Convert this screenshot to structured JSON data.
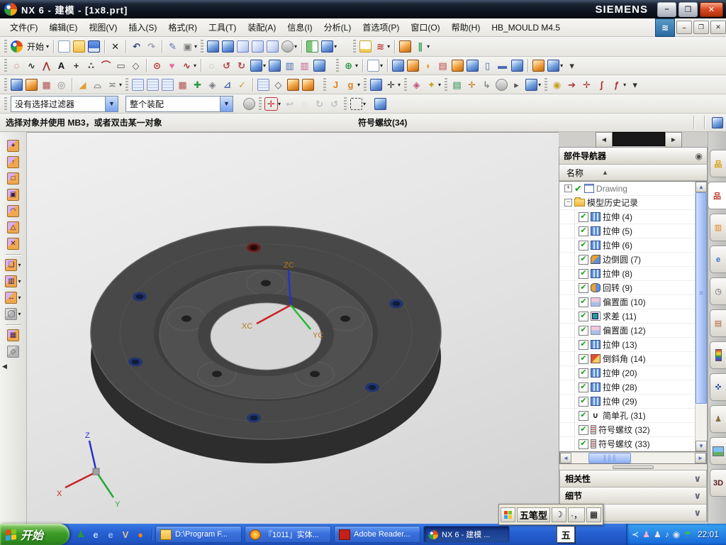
{
  "window": {
    "title": "NX 6 - 建模 - [1x8.prt]",
    "brand": "SIEMENS",
    "min_label": "–",
    "max_label": "❐",
    "close_label": "✕"
  },
  "menu_bar": {
    "items": [
      "文件(F)",
      "编辑(E)",
      "视图(V)",
      "插入(S)",
      "格式(R)",
      "工具(T)",
      "装配(A)",
      "信息(I)",
      "分析(L)",
      "首选项(P)",
      "窗口(O)",
      "帮助(H)"
    ],
    "suffix": "HB_MOULD M4.5"
  },
  "toolbars": {
    "row1": [
      {
        "t": "grip"
      },
      {
        "n": "nx-start-logo",
        "k": "logo"
      },
      {
        "n": "start-menu",
        "k": "label",
        "g": "开始",
        "a": 1
      },
      {
        "t": "sep"
      },
      {
        "n": "new-part",
        "k": "page"
      },
      {
        "n": "open-part",
        "k": "folder"
      },
      {
        "n": "save-part",
        "k": "floppy"
      },
      {
        "t": "sep"
      },
      {
        "n": "delete",
        "k": "glyph",
        "g": "✕",
        "c": "#1a1a1a"
      },
      {
        "t": "sep"
      },
      {
        "n": "undo",
        "k": "glyph",
        "g": "↶",
        "c": "#33427a"
      },
      {
        "n": "redo",
        "k": "glyph",
        "g": "↷",
        "c": "#9aa0ae"
      },
      {
        "t": "sep"
      },
      {
        "n": "measure-distance",
        "k": "glyph",
        "g": "✎",
        "c": "#5a6fb0"
      },
      {
        "n": "screen-layout",
        "k": "glyph",
        "g": "▣",
        "c": "#7a7a7a",
        "a": 1
      },
      {
        "t": "grip"
      },
      {
        "n": "shaded-with-edges",
        "k": "cubeb"
      },
      {
        "n": "shaded",
        "k": "cubeb"
      },
      {
        "n": "wireframe-dim-edges",
        "k": "cube"
      },
      {
        "n": "wireframe-hidden-edges",
        "k": "cube"
      },
      {
        "n": "static-wireframe",
        "k": "cube"
      },
      {
        "n": "face-analysis",
        "k": "gray",
        "a": 1
      },
      {
        "t": "sep"
      },
      {
        "n": "orient-view-left",
        "k": "split"
      },
      {
        "n": "orient-view",
        "k": "cubeb",
        "a": 1
      },
      {
        "t": "gap",
        "w": 18
      },
      {
        "t": "grip"
      },
      {
        "n": "datum-display",
        "k": "docy"
      },
      {
        "n": "edge-display",
        "k": "glyph",
        "g": "≋",
        "c": "#c03030",
        "a": 1
      },
      {
        "t": "sep"
      },
      {
        "n": "role-designer",
        "k": "cubeo"
      },
      {
        "n": "routing-pipes",
        "k": "glyph",
        "g": "∥",
        "c": "#2a9a4a",
        "a": 1
      }
    ],
    "row2": [
      {
        "t": "grip"
      },
      {
        "n": "profile",
        "k": "glyph",
        "g": "◌",
        "c": "#b03030"
      },
      {
        "n": "spline",
        "k": "glyph",
        "g": "∿",
        "c": "#333333"
      },
      {
        "n": "polyline",
        "k": "glyph",
        "g": "⋀",
        "c": "#a03030"
      },
      {
        "n": "sketch-text",
        "k": "glyph",
        "g": "A",
        "c": "#111111"
      },
      {
        "n": "point",
        "k": "glyph",
        "g": "+",
        "c": "#333333"
      },
      {
        "n": "point-set",
        "k": "glyph",
        "g": "∴",
        "c": "#555555"
      },
      {
        "n": "sketch-fillet",
        "k": "glyph",
        "g": "⌒",
        "c": "#b03030"
      },
      {
        "n": "rectangle",
        "k": "glyph",
        "g": "▭",
        "c": "#555555"
      },
      {
        "n": "polygon",
        "k": "glyph",
        "g": "◇",
        "c": "#555555"
      },
      {
        "t": "sep"
      },
      {
        "n": "ellipse",
        "k": "glyph",
        "g": "⊙",
        "c": "#b03030"
      },
      {
        "n": "conic",
        "k": "glyph",
        "g": "♥",
        "c": "#e070a0"
      },
      {
        "n": "studio-spline",
        "k": "glyph",
        "g": "∿",
        "c": "#b03030",
        "a": 1
      },
      {
        "t": "sep"
      },
      {
        "n": "quick-trim",
        "k": "glyph",
        "g": "◌",
        "c": "#999999"
      },
      {
        "n": "quick-extend",
        "k": "glyph",
        "g": "↺",
        "c": "#b04040"
      },
      {
        "n": "make-corner",
        "k": "glyph",
        "g": "↻",
        "c": "#b04040"
      },
      {
        "n": "sketch",
        "k": "cubeb",
        "a": 1
      },
      {
        "n": "sketch-in-task",
        "k": "cubeb"
      },
      {
        "n": "sketch-curve",
        "k": "glyph",
        "g": "▥",
        "c": "#4a6ab0"
      },
      {
        "n": "sketch-constraints",
        "k": "glyph",
        "g": "▥",
        "c": "#c06090"
      },
      {
        "n": "finish-sketch",
        "k": "cubeb"
      },
      {
        "t": "gap",
        "w": 10
      },
      {
        "t": "grip"
      },
      {
        "n": "datum-csys",
        "k": "glyph",
        "g": "⊕",
        "c": "#2a9a4a",
        "a": 1
      },
      {
        "t": "sep"
      },
      {
        "n": "datum-plane",
        "k": "page",
        "a": 1
      },
      {
        "t": "sep"
      },
      {
        "n": "extrude",
        "k": "cubeb"
      },
      {
        "n": "revolve",
        "k": "cubeo"
      },
      {
        "n": "sweep-along-guide",
        "k": "glyph",
        "g": "◖",
        "c": "#e0a020"
      },
      {
        "n": "emboss",
        "k": "glyph",
        "g": "▤",
        "c": "#c04040"
      },
      {
        "n": "hole",
        "k": "cubeo"
      },
      {
        "n": "pocket",
        "k": "cubeb"
      },
      {
        "n": "boss",
        "k": "glyph",
        "g": "▯",
        "c": "#4a6ab0"
      },
      {
        "n": "slot",
        "k": "glyph",
        "g": "▬",
        "c": "#4a6ab0"
      },
      {
        "n": "groove",
        "k": "cubeb"
      },
      {
        "t": "sep"
      },
      {
        "n": "unite",
        "k": "cubeo"
      },
      {
        "n": "subtract",
        "k": "cubeb",
        "a": 1
      },
      {
        "n": "toolbar-options",
        "k": "glyph",
        "g": "▾",
        "c": "#333333"
      }
    ],
    "row3": [
      {
        "t": "grip"
      },
      {
        "n": "extract-body",
        "k": "cubeb"
      },
      {
        "n": "shell",
        "k": "cubeo"
      },
      {
        "n": "pattern-feature",
        "k": "glyph",
        "g": "▦",
        "c": "#b05050"
      },
      {
        "n": "tube",
        "k": "glyph",
        "g": "◎",
        "c": "#888888"
      },
      {
        "t": "sep"
      },
      {
        "n": "trim-body",
        "k": "glyph",
        "g": "◢",
        "c": "#e0a030"
      },
      {
        "n": "dome",
        "k": "glyph",
        "g": "⌓",
        "c": "#888888"
      },
      {
        "n": "offset-face",
        "k": "glyph",
        "g": "≍",
        "c": "#888888",
        "a": 1
      },
      {
        "t": "grip"
      },
      {
        "n": "ruled-surface",
        "k": "sheet"
      },
      {
        "n": "through-curves",
        "k": "sheet"
      },
      {
        "n": "through-curve-mesh",
        "k": "sheet"
      },
      {
        "n": "lattice-surface",
        "k": "glyph",
        "g": "▦",
        "c": "#b05050"
      },
      {
        "n": "n-sided-surface",
        "k": "glyph",
        "g": "✚",
        "c": "#2a9a4a"
      },
      {
        "n": "sew",
        "k": "glyph",
        "g": "◈",
        "c": "#777788"
      },
      {
        "n": "trim-sheet",
        "k": "glyph",
        "g": "⊿",
        "c": "#4a6ab0"
      },
      {
        "n": "surface-wand",
        "k": "glyph",
        "g": "✓",
        "c": "#c8a020"
      },
      {
        "t": "sep"
      },
      {
        "n": "grid-surface",
        "k": "sheet"
      },
      {
        "n": "bow-surface",
        "k": "glyph",
        "g": "◇",
        "c": "#555566"
      },
      {
        "n": "swoop-surface",
        "k": "cubeo"
      },
      {
        "n": "bounded-plane",
        "k": "cubeo"
      },
      {
        "t": "gap",
        "w": 8
      },
      {
        "t": "grip"
      },
      {
        "n": "edge-blend",
        "k": "glyph",
        "g": "J",
        "c": "#e08020"
      },
      {
        "n": "face-blend",
        "k": "glyph",
        "g": "g",
        "c": "#e08020",
        "a": 1
      },
      {
        "t": "grip"
      },
      {
        "n": "view-section",
        "k": "cubeb"
      },
      {
        "n": "wcs-dynamics",
        "k": "glyph",
        "g": "✛",
        "c": "#333333",
        "a": 1
      },
      {
        "t": "grip"
      },
      {
        "n": "information-window",
        "k": "glyph",
        "g": "◈",
        "c": "#c05080"
      },
      {
        "n": "visualization-preferences",
        "k": "glyph",
        "g": "✦",
        "c": "#c8a020",
        "a": 1
      },
      {
        "t": "grip"
      },
      {
        "n": "layer-settings",
        "k": "glyph",
        "g": "▤",
        "c": "#2a8a4a"
      },
      {
        "n": "csys-orientation",
        "k": "glyph",
        "g": "✛",
        "c": "#c07820"
      },
      {
        "n": "unlock-objects",
        "k": "glyph",
        "g": "↳",
        "c": "#888888"
      },
      {
        "n": "ghost-body",
        "k": "gray"
      },
      {
        "n": "selection-arrow",
        "k": "glyph",
        "g": "▸",
        "c": "#555555"
      },
      {
        "n": "move-component",
        "k": "cubeb",
        "a": 1
      },
      {
        "t": "grip"
      },
      {
        "n": "snap-ball",
        "k": "glyph",
        "g": "◉",
        "c": "#c8a020"
      },
      {
        "n": "derived-line",
        "k": "glyph",
        "g": "➔",
        "c": "#b03030"
      },
      {
        "n": "snap-cross",
        "k": "glyph",
        "g": "✛",
        "c": "#b03030"
      },
      {
        "n": "law-curve",
        "k": "glyph",
        "g": "∫",
        "c": "#b03030"
      },
      {
        "n": "spline-law",
        "k": "glyph",
        "g": "ƒ",
        "c": "#b03030",
        "a": 1
      },
      {
        "n": "toolbar-options-2",
        "k": "glyph",
        "g": "▾",
        "c": "#333333"
      }
    ],
    "selection_row": [
      {
        "t": "grip"
      },
      {
        "t": "dd",
        "bind": "filter",
        "nm": "selection-filter-dropdown"
      },
      {
        "t": "gap",
        "w": 6
      },
      {
        "t": "dd",
        "bind": "scope",
        "nm": "selection-scope-dropdown"
      },
      {
        "t": "gap",
        "w": 10
      },
      {
        "n": "select-within-assembly",
        "k": "gray"
      },
      {
        "t": "grip"
      },
      {
        "n": "snap-point-toggle",
        "k": "glyph",
        "g": "✛",
        "c": "#c03030",
        "a": 1,
        "box": 1
      },
      {
        "n": "step-back",
        "k": "glyph",
        "g": "↩",
        "c": "#99a0aa",
        "dim": 1
      },
      {
        "n": "deselect-all",
        "k": "glyph",
        "g": "◌",
        "c": "#99a0aa",
        "dim": 1
      },
      {
        "n": "rotate-view",
        "k": "glyph",
        "g": "↻",
        "c": "#99a0aa",
        "dim": 1
      },
      {
        "n": "pan-view",
        "k": "glyph",
        "g": "↺",
        "c": "#99a0aa",
        "dim": 1
      },
      {
        "t": "grip"
      },
      {
        "n": "rectangle-select",
        "k": "marquee",
        "a": 1
      },
      {
        "t": "gap",
        "w": 8
      },
      {
        "n": "preview-shaded",
        "k": "cubeb"
      }
    ],
    "sidebar": [
      {
        "n": "move-face",
        "k": "scube",
        "g": "+"
      },
      {
        "n": "pull-face",
        "k": "scube",
        "g": "↑"
      },
      {
        "n": "offset-region",
        "k": "scube",
        "g": "□"
      },
      {
        "n": "replace-face",
        "k": "scube",
        "g": "▣"
      },
      {
        "n": "resize-blend",
        "k": "scube",
        "g": "◠"
      },
      {
        "n": "resize-face",
        "k": "scube",
        "g": "△"
      },
      {
        "n": "delete-face",
        "k": "scube",
        "g": "✕"
      },
      {
        "t": "hsep"
      },
      {
        "n": "copy-face",
        "k": "scube",
        "g": "❏",
        "a": 1
      },
      {
        "n": "paste-face",
        "k": "scube",
        "g": "▥",
        "a": 1
      },
      {
        "n": "linear-dimension",
        "k": "scube",
        "g": "↔",
        "a": 1
      },
      {
        "n": "shell-body",
        "k": "sgray",
        "g": "◯",
        "a": 1
      },
      {
        "t": "hsep"
      },
      {
        "n": "pattern-face",
        "k": "scube",
        "g": "▦"
      },
      {
        "n": "edit-cross-section",
        "k": "sgray",
        "g": "◇"
      },
      {
        "t": "collapse"
      }
    ]
  },
  "selection_bar": {
    "filter_value": "没有选择过滤器",
    "scope_value": "整个装配"
  },
  "status_bar": {
    "prompt": "选择对象并使用 MB3，或者双击某一对象",
    "message": "符号螺纹(34)"
  },
  "viewport": {
    "wcs": {
      "x": "XC",
      "y": "YC",
      "z": "ZC"
    },
    "triad": {
      "x": "X",
      "y": "Y",
      "z": "Z"
    }
  },
  "part_navigator": {
    "title": "部件导航器",
    "column": "名称",
    "tree": [
      {
        "label": "Drawing",
        "icon": "drawing",
        "exp": "+",
        "check": "mark",
        "level": 0,
        "muted": true
      },
      {
        "label": "模型历史记录",
        "icon": "folder",
        "exp": "−",
        "level": 0
      },
      {
        "label": "拉伸 (4)",
        "icon": "extrude",
        "checked": true
      },
      {
        "label": "拉伸 (5)",
        "icon": "extrude",
        "checked": true
      },
      {
        "label": "拉伸 (6)",
        "icon": "extrude",
        "checked": true
      },
      {
        "label": "边倒圆 (7)",
        "icon": "blend",
        "checked": true
      },
      {
        "label": "拉伸 (8)",
        "icon": "extrude",
        "checked": true
      },
      {
        "label": "回转 (9)",
        "icon": "revolve",
        "checked": true
      },
      {
        "label": "偏置面 (10)",
        "icon": "offset",
        "checked": true
      },
      {
        "label": "求差 (11)",
        "icon": "subtract",
        "checked": true
      },
      {
        "label": "偏置面 (12)",
        "icon": "offset",
        "checked": true
      },
      {
        "label": "拉伸 (13)",
        "icon": "extrude",
        "checked": true
      },
      {
        "label": "倒斜角 (14)",
        "icon": "chamfer",
        "checked": true
      },
      {
        "label": "拉伸 (20)",
        "icon": "extrude",
        "checked": true
      },
      {
        "label": "拉伸 (28)",
        "icon": "extrude",
        "checked": true
      },
      {
        "label": "拉伸 (29)",
        "icon": "extrude",
        "checked": true
      },
      {
        "label": "简单孔 (31)",
        "icon": "hole",
        "glyph": "∪",
        "checked": true
      },
      {
        "label": "符号螺纹 (32)",
        "icon": "thread",
        "checked": true
      },
      {
        "label": "符号螺纹 (33)",
        "icon": "thread",
        "checked": true
      }
    ],
    "sections": [
      "相关性",
      "细节",
      ""
    ]
  },
  "resource_tabs": [
    {
      "n": "assembly-navigator",
      "g": "品",
      "c": "#d4a017"
    },
    {
      "n": "part-navigator",
      "g": "品",
      "c": "#c0392b",
      "active": 1
    },
    {
      "n": "constraint-navigator",
      "g": "▥",
      "c": "#e67e22"
    },
    {
      "n": "internet-explorer",
      "g": "e",
      "c": "#2e6fd0"
    },
    {
      "n": "history",
      "g": "◷",
      "c": "#555566"
    },
    {
      "n": "system-materials",
      "g": "▤",
      "c": "#b06030"
    },
    {
      "n": "palette",
      "k": "rainbow"
    },
    {
      "n": "visualization",
      "g": "✜",
      "c": "#3355aa"
    },
    {
      "n": "roles",
      "g": "♟",
      "c": "#8a6d3b"
    },
    {
      "n": "gallery",
      "k": "photo"
    },
    {
      "n": "hd3d",
      "g": "3D",
      "c": "#5a1a1a"
    }
  ],
  "ime_bar": {
    "label": "五笔型",
    "moon": "☽",
    "punct": "·，",
    "keyboard": "▦"
  },
  "taskbar": {
    "start": "开始",
    "quick_launch": [
      {
        "n": "user-status",
        "g": "♟",
        "c": "#2a9a2a"
      },
      {
        "n": "internet-explorer",
        "g": "e",
        "c": "#bcd8ff"
      },
      {
        "n": "internet-explorer-2",
        "g": "e",
        "c": "#8ab4ff"
      },
      {
        "n": "winrar",
        "g": "V",
        "c": "#e8c890"
      },
      {
        "n": "firefox",
        "g": "●",
        "c": "#f08020"
      }
    ],
    "tasks": [
      {
        "label": "D:\\Program F...",
        "icon": "folder"
      },
      {
        "label": "『1011』实体...",
        "icon": "firefox"
      },
      {
        "label": "Adobe Reader...",
        "icon": "adobe"
      },
      {
        "label": "NX 6 - 建模 ...",
        "icon": "nx",
        "active": true
      }
    ],
    "ime": "五",
    "tray": [
      {
        "n": "nx-agent",
        "g": "≺",
        "c": "#cfe4ff"
      },
      {
        "n": "qq-1",
        "g": "♟",
        "c": "#ffb0d0"
      },
      {
        "n": "qq-2",
        "g": "♟",
        "c": "#f0e6e6"
      },
      {
        "n": "media-player",
        "g": "♪",
        "c": "#cfe0ff"
      },
      {
        "n": "volume",
        "g": "◉",
        "c": "#dfe4ea"
      },
      {
        "n": "umbrella-antivirus",
        "g": "☂",
        "c": "#3ac04a"
      }
    ],
    "clock": "22:01"
  }
}
